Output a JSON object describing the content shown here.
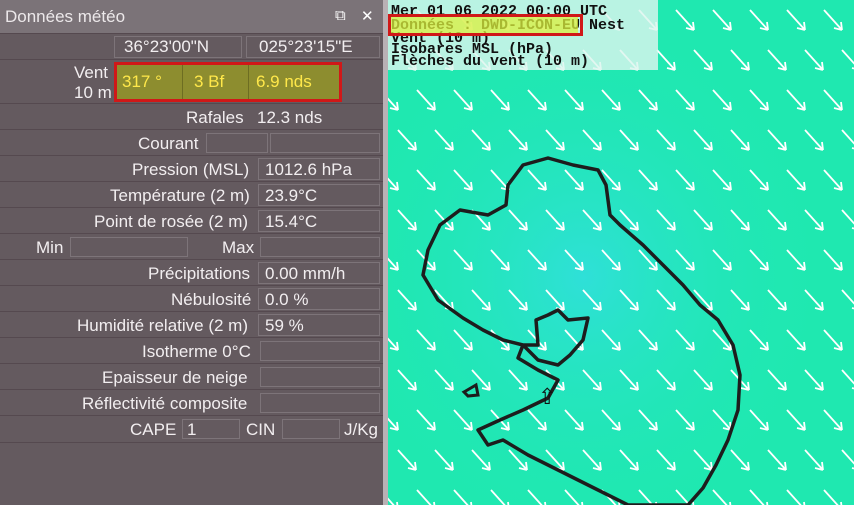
{
  "panel": {
    "title": "Données météo",
    "float_icon": "⧉",
    "close_icon": "✕",
    "lat": "36°23'00\"N",
    "lon": "025°23'15\"E",
    "wind_label_1": "Vent",
    "wind_label_2": "10 m",
    "wind_dir": "317 °",
    "wind_bf": "3 Bf",
    "wind_speed": "6.9  nds",
    "gust_label": "Rafales",
    "gust_value": "12.3  nds",
    "current_label": "Courant",
    "pressure_label": "Pression (MSL)",
    "pressure_value": "1012.6 hPa",
    "temp_label": "Température (2 m)",
    "temp_value": "23.9°C",
    "dew_label": "Point de rosée (2 m)",
    "dew_value": "15.4°C",
    "min_label": "Min",
    "max_label": "Max",
    "precip_label": "Précipitations",
    "precip_value": "0.00 mm/h",
    "cloud_label": "Nébulosité",
    "cloud_value": "0.0 %",
    "humidity_label": "Humidité relative (2 m)",
    "humidity_value": "59 %",
    "iso_label": "Isotherme 0°C",
    "snow_label": "Epaisseur de neige",
    "reflect_label": "Réflectivité composite",
    "cape_label": "CAPE",
    "cape_value": "1",
    "cin_label": "CIN",
    "jkg_label": "J/Kg"
  },
  "map": {
    "line1": "Mer 01 06 2022 00:00 UTC",
    "line2": "Données : DWD-ICON-EU Nest",
    "line3": "Vent (10 m)",
    "line4": "Isobares MSL (hPa)",
    "line5": "Flèches du vent (10 m)",
    "cursor_icon": "⇧",
    "background_color": "#1fe8b0",
    "highlight_color": "#d01818",
    "arrow_color": "#ffffff"
  }
}
